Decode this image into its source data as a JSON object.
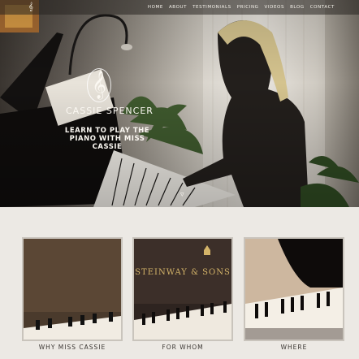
{
  "nav": {
    "logo_icon": "treble-clef-icon",
    "links": [
      "HOME",
      "ABOUT",
      "TESTIMONIALS",
      "PRICING",
      "VIDEOS",
      "BLOG",
      "CONTACT"
    ]
  },
  "hero": {
    "brand_icon": "treble-clef-icon",
    "brand_name": "CASSIE SPENCER",
    "tagline": "LEARN TO PLAY THE PIANO WITH MISS CASSIE",
    "scroll_icon": "chevron-down-icon"
  },
  "features": {
    "cards": [
      {
        "label": "WHY MISS CASSIE"
      },
      {
        "label": "FOR WHOM",
        "brand_text": "STEINWAY & SONS"
      },
      {
        "label": "WHERE"
      }
    ]
  },
  "colors": {
    "page_background": "#ece9e4",
    "nav_text": "#f4f1ea",
    "accent_gold": "#d4b469"
  }
}
